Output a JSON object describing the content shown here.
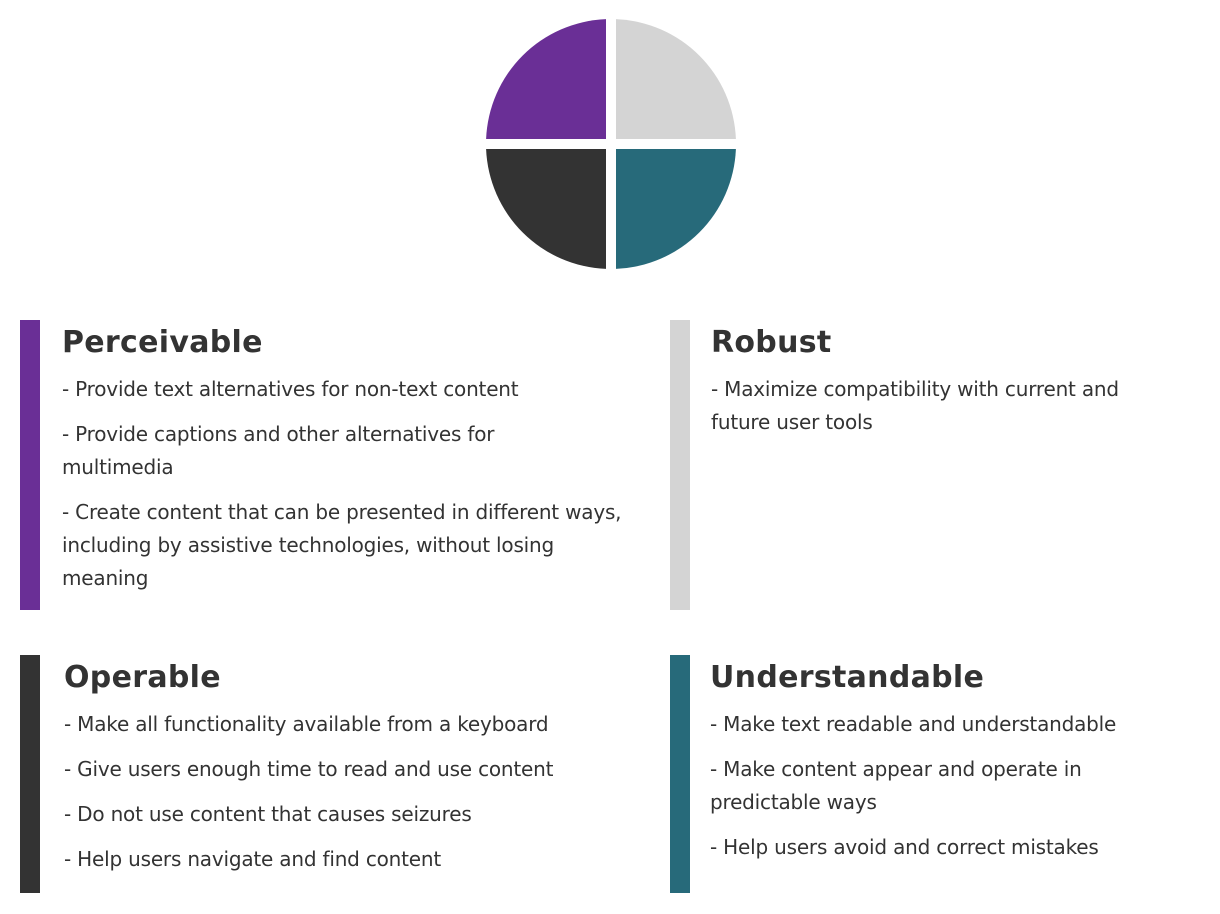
{
  "diagram": {
    "title_hidden": "",
    "quadrants": [
      {
        "key": "perceivable",
        "position": "top-left",
        "color": "#6a2f96"
      },
      {
        "key": "robust",
        "position": "top-right",
        "color": "#d4d4d4"
      },
      {
        "key": "operable",
        "position": "bottom-left",
        "color": "#333333"
      },
      {
        "key": "understandable",
        "position": "bottom-right",
        "color": "#276a7a"
      }
    ]
  },
  "principles": {
    "perceivable": {
      "title": "Perceivable",
      "color": "#6a2f96",
      "items": [
        "- Provide text alternatives for non-text content",
        "- Provide captions and other alternatives for multimedia",
        "- Create content that can be presented in different ways, including by assistive technologies, without losing meaning"
      ]
    },
    "robust": {
      "title": "Robust",
      "color": "#d4d4d4",
      "items": [
        "- Maximize compatibility with current and future user tools"
      ]
    },
    "operable": {
      "title": "Operable",
      "color": "#333333",
      "items": [
        "- Make all functionality available from a keyboard",
        "- Give users enough time to read and use content",
        "- Do not use content that causes seizures",
        "- Help users navigate and find content"
      ]
    },
    "understandable": {
      "title": "Understandable",
      "color": "#276a7a",
      "items": [
        "- Make text readable and understandable",
        "- Make content appear and operate in predictable ways",
        "- Help users avoid and correct mistakes"
      ]
    }
  }
}
